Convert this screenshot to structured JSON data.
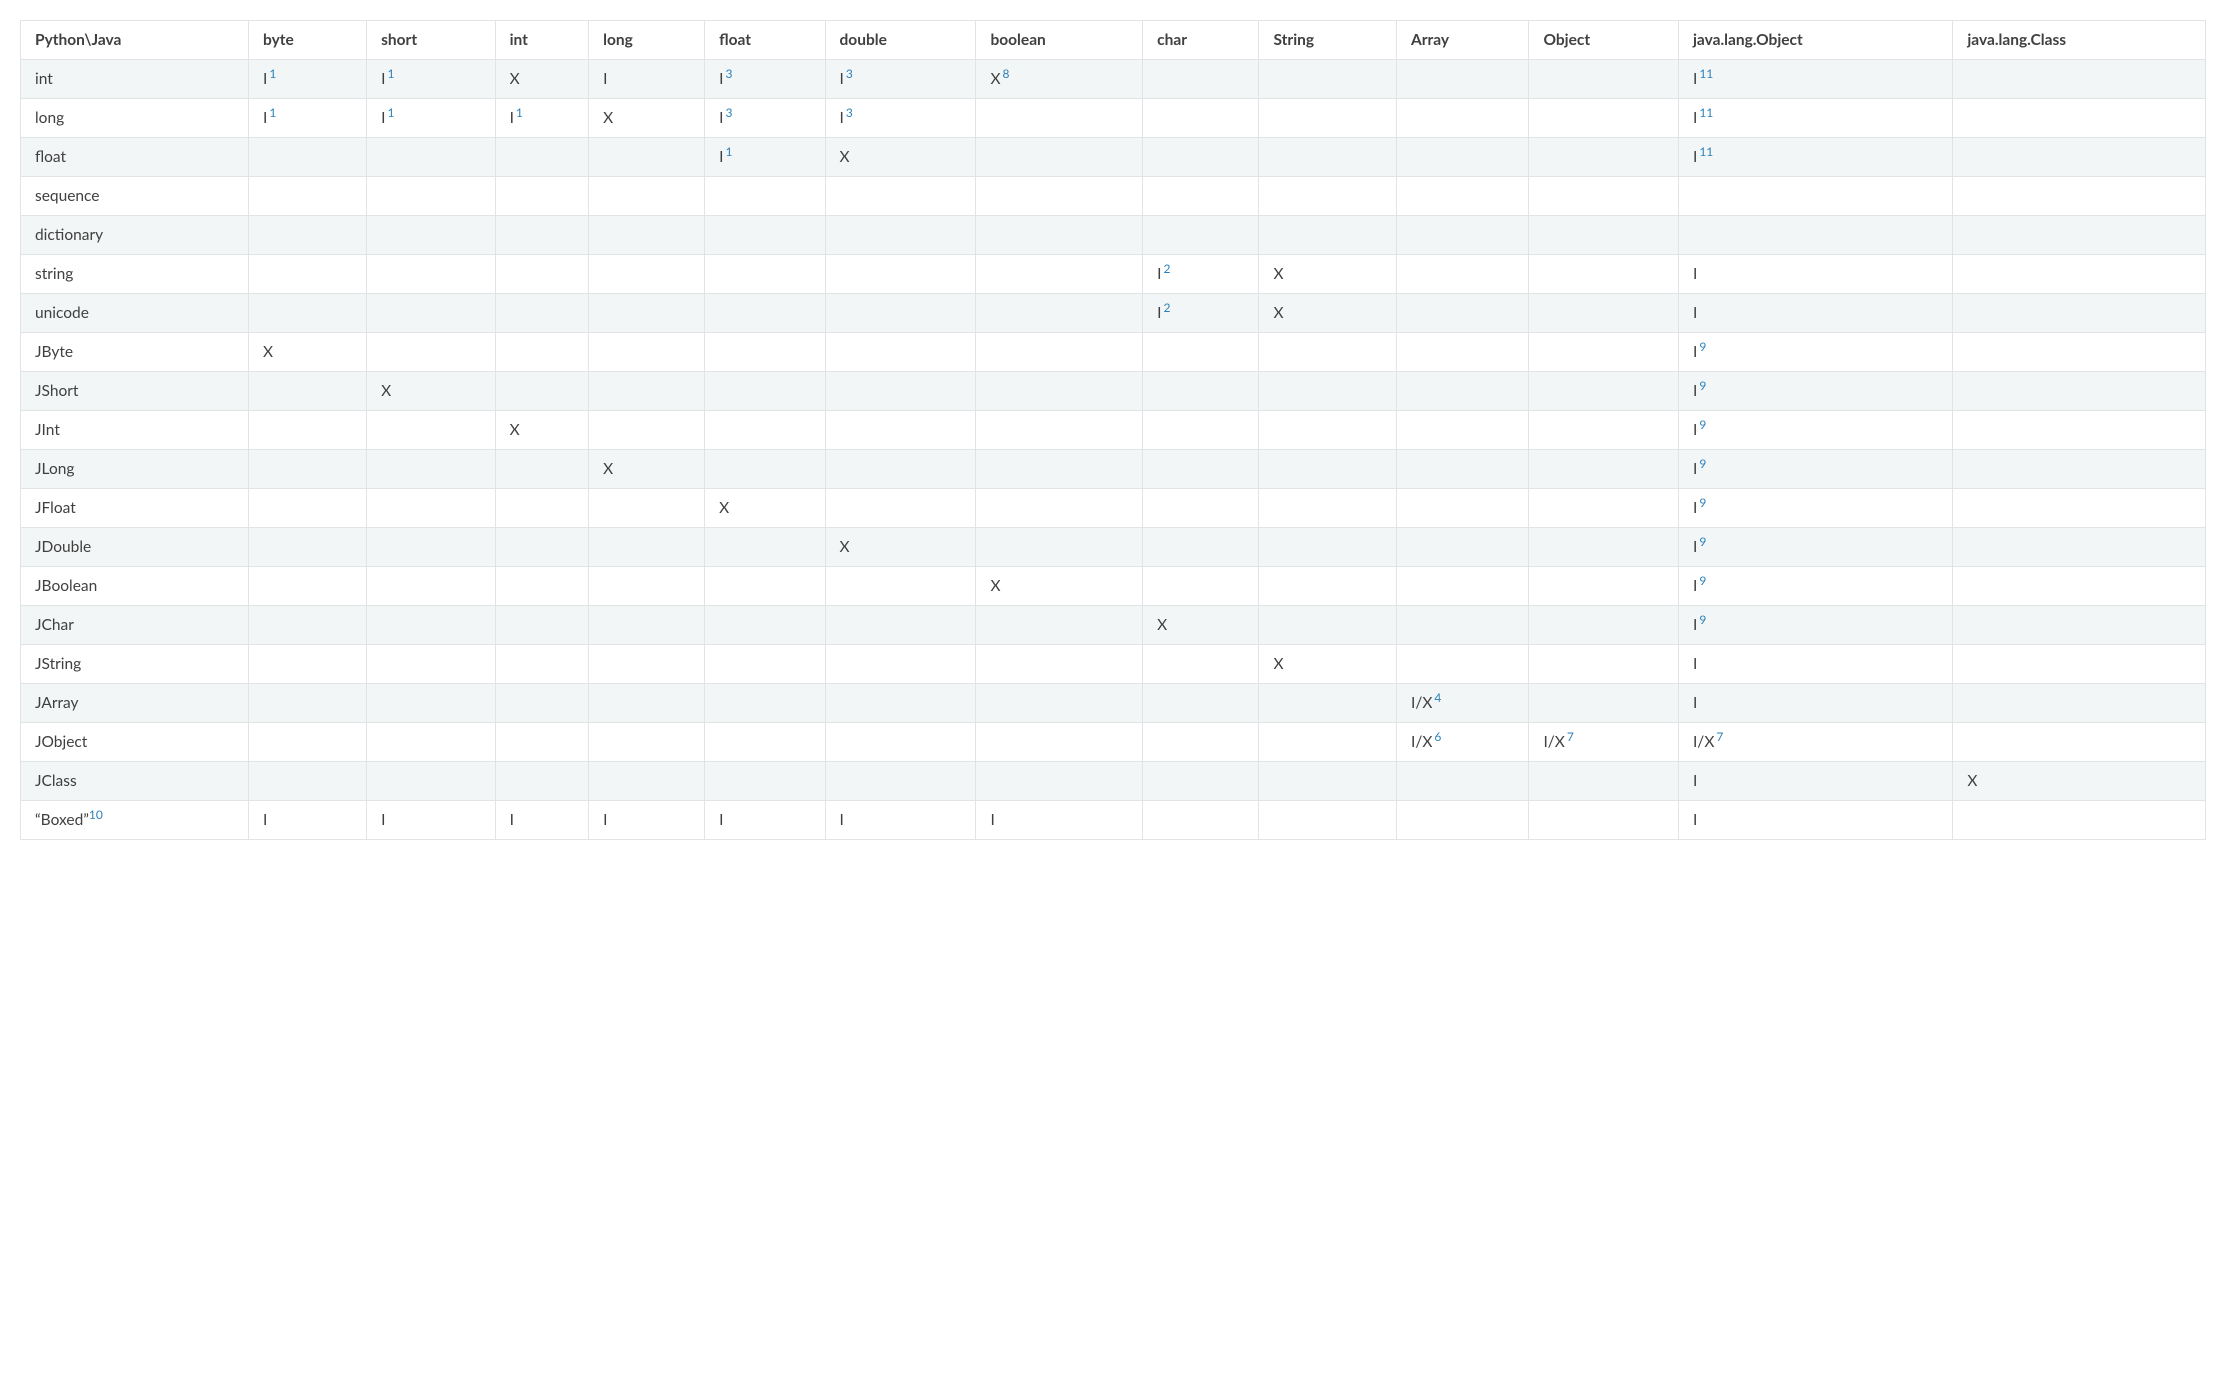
{
  "columns": [
    "Python\\Java",
    "byte",
    "short",
    "int",
    "long",
    "float",
    "double",
    "boolean",
    "char",
    "String",
    "Array",
    "Object",
    "java.lang.Object",
    "java.lang.Class"
  ],
  "rows": [
    {
      "label": "int",
      "cells": [
        {
          "v": "I",
          "n": "1"
        },
        {
          "v": "I",
          "n": "1"
        },
        {
          "v": "X"
        },
        {
          "v": "I"
        },
        {
          "v": "I",
          "n": "3"
        },
        {
          "v": "I",
          "n": "3"
        },
        {
          "v": "X",
          "n": "8"
        },
        {},
        {},
        {},
        {},
        {
          "v": "I",
          "n": "11"
        },
        {}
      ]
    },
    {
      "label": "long",
      "cells": [
        {
          "v": "I",
          "n": "1"
        },
        {
          "v": "I",
          "n": "1"
        },
        {
          "v": "I",
          "n": "1"
        },
        {
          "v": "X"
        },
        {
          "v": "I",
          "n": "3"
        },
        {
          "v": "I",
          "n": "3"
        },
        {},
        {},
        {},
        {},
        {},
        {
          "v": "I",
          "n": "11"
        },
        {}
      ]
    },
    {
      "label": "float",
      "cells": [
        {},
        {},
        {},
        {},
        {
          "v": "I",
          "n": "1"
        },
        {
          "v": "X"
        },
        {},
        {},
        {},
        {},
        {},
        {
          "v": "I",
          "n": "11"
        },
        {}
      ]
    },
    {
      "label": "sequence",
      "cells": [
        {},
        {},
        {},
        {},
        {},
        {},
        {},
        {},
        {},
        {},
        {},
        {},
        {}
      ]
    },
    {
      "label": "dictionary",
      "cells": [
        {},
        {},
        {},
        {},
        {},
        {},
        {},
        {},
        {},
        {},
        {},
        {},
        {}
      ]
    },
    {
      "label": "string",
      "cells": [
        {},
        {},
        {},
        {},
        {},
        {},
        {},
        {
          "v": "I",
          "n": "2"
        },
        {
          "v": "X"
        },
        {},
        {},
        {
          "v": "I"
        },
        {}
      ]
    },
    {
      "label": "unicode",
      "cells": [
        {},
        {},
        {},
        {},
        {},
        {},
        {},
        {
          "v": "I",
          "n": "2"
        },
        {
          "v": "X"
        },
        {},
        {},
        {
          "v": "I"
        },
        {}
      ]
    },
    {
      "label": "JByte",
      "cells": [
        {
          "v": "X"
        },
        {},
        {},
        {},
        {},
        {},
        {},
        {},
        {},
        {},
        {},
        {
          "v": "I",
          "n": "9"
        },
        {}
      ]
    },
    {
      "label": "JShort",
      "cells": [
        {},
        {
          "v": "X"
        },
        {},
        {},
        {},
        {},
        {},
        {},
        {},
        {},
        {},
        {
          "v": "I",
          "n": "9"
        },
        {}
      ]
    },
    {
      "label": "JInt",
      "cells": [
        {},
        {},
        {
          "v": "X"
        },
        {},
        {},
        {},
        {},
        {},
        {},
        {},
        {},
        {
          "v": "I",
          "n": "9"
        },
        {}
      ]
    },
    {
      "label": "JLong",
      "cells": [
        {},
        {},
        {},
        {
          "v": "X"
        },
        {},
        {},
        {},
        {},
        {},
        {},
        {},
        {
          "v": "I",
          "n": "9"
        },
        {}
      ]
    },
    {
      "label": "JFloat",
      "cells": [
        {},
        {},
        {},
        {},
        {
          "v": "X"
        },
        {},
        {},
        {},
        {},
        {},
        {},
        {
          "v": "I",
          "n": "9"
        },
        {}
      ]
    },
    {
      "label": "JDouble",
      "cells": [
        {},
        {},
        {},
        {},
        {},
        {
          "v": "X"
        },
        {},
        {},
        {},
        {},
        {},
        {
          "v": "I",
          "n": "9"
        },
        {}
      ]
    },
    {
      "label": "JBoolean",
      "cells": [
        {},
        {},
        {},
        {},
        {},
        {},
        {
          "v": "X"
        },
        {},
        {},
        {},
        {},
        {
          "v": "I",
          "n": "9"
        },
        {}
      ]
    },
    {
      "label": "JChar",
      "cells": [
        {},
        {},
        {},
        {},
        {},
        {},
        {},
        {
          "v": "X"
        },
        {},
        {},
        {},
        {
          "v": "I",
          "n": "9"
        },
        {}
      ]
    },
    {
      "label": "JString",
      "cells": [
        {},
        {},
        {},
        {},
        {},
        {},
        {},
        {},
        {
          "v": "X"
        },
        {},
        {},
        {
          "v": "I"
        },
        {}
      ]
    },
    {
      "label": "JArray",
      "cells": [
        {},
        {},
        {},
        {},
        {},
        {},
        {},
        {},
        {},
        {
          "v": "I/X",
          "n": "4"
        },
        {},
        {
          "v": "I"
        },
        {}
      ]
    },
    {
      "label": "JObject",
      "cells": [
        {},
        {},
        {},
        {},
        {},
        {},
        {},
        {},
        {},
        {
          "v": "I/X",
          "n": "6"
        },
        {
          "v": "I/X",
          "n": "7"
        },
        {
          "v": "I/X",
          "n": "7"
        },
        {}
      ]
    },
    {
      "label": "JClass",
      "cells": [
        {},
        {},
        {},
        {},
        {},
        {},
        {},
        {},
        {},
        {},
        {},
        {
          "v": "I"
        },
        {
          "v": "X"
        }
      ]
    },
    {
      "label": "“Boxed”",
      "labelNote": "10",
      "cells": [
        {
          "v": "I"
        },
        {
          "v": "I"
        },
        {
          "v": "I"
        },
        {
          "v": "I"
        },
        {
          "v": "I"
        },
        {
          "v": "I"
        },
        {
          "v": "I"
        },
        {},
        {},
        {},
        {},
        {
          "v": "I"
        },
        {}
      ]
    }
  ]
}
